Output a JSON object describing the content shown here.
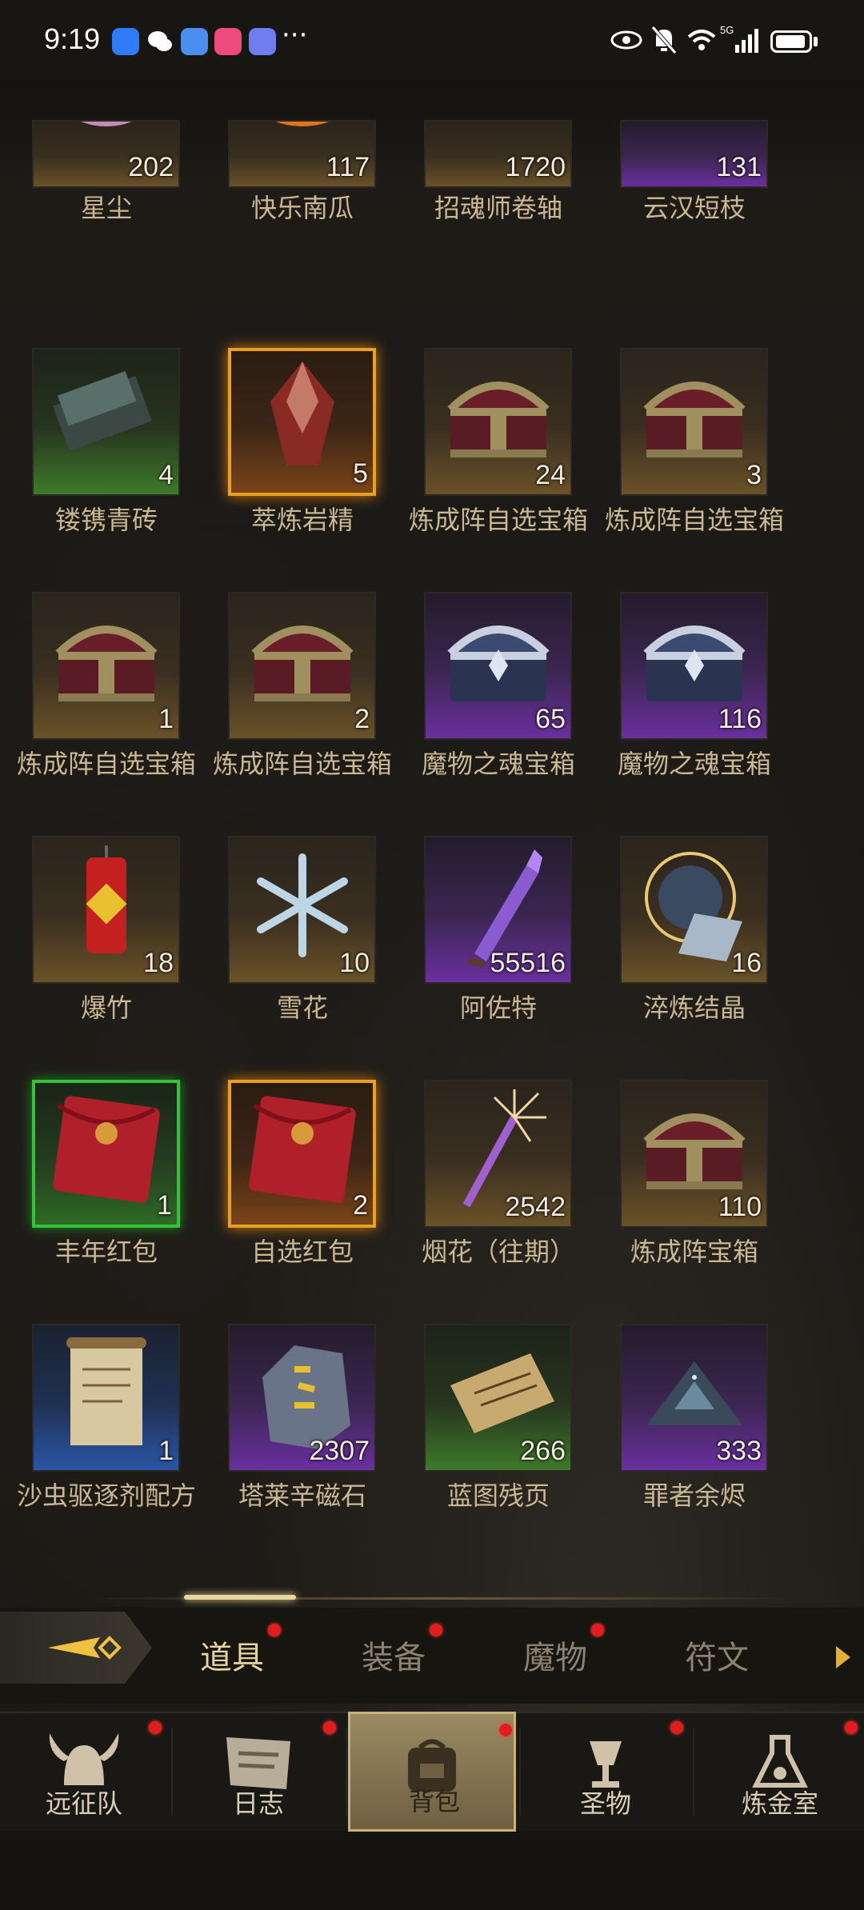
{
  "status_bar": {
    "time": "9:19",
    "dots": "···",
    "icons": [
      "shield-app-icon",
      "wechat-icon",
      "browser-app-icon",
      "lofter-app-icon",
      "music-app-icon",
      "eye-icon",
      "mute-bell-icon",
      "wifi-icon",
      "signal-5g-icon",
      "battery-icon"
    ],
    "network": "5G"
  },
  "items": [
    {
      "name": "星尘",
      "count": "202",
      "rarity": "gold",
      "icon": "stardust-icon"
    },
    {
      "name": "快乐南瓜",
      "count": "117",
      "rarity": "gold",
      "icon": "pumpkin-icon"
    },
    {
      "name": "招魂师卷轴",
      "count": "1720",
      "rarity": "gold",
      "icon": "scroll-icon"
    },
    {
      "name": "云汉短枝",
      "count": "131",
      "rarity": "purple",
      "icon": "branch-icon"
    },
    {
      "name": "镂镌青砖",
      "count": "4",
      "rarity": "green",
      "icon": "brick-icon"
    },
    {
      "name": "萃炼岩精",
      "count": "5",
      "rarity": "orange",
      "icon": "crystal-icon"
    },
    {
      "name": "炼成阵自选宝箱",
      "count": "24",
      "rarity": "gold",
      "icon": "chest-icon"
    },
    {
      "name": "炼成阵自选宝箱",
      "count": "3",
      "rarity": "gold",
      "icon": "chest-icon"
    },
    {
      "name": "炼成阵自选宝箱",
      "count": "1",
      "rarity": "gold",
      "icon": "chest-icon"
    },
    {
      "name": "炼成阵自选宝箱",
      "count": "2",
      "rarity": "gold",
      "icon": "chest-icon"
    },
    {
      "name": "魔物之魂宝箱",
      "count": "65",
      "rarity": "purple",
      "icon": "silver-chest-icon"
    },
    {
      "name": "魔物之魂宝箱",
      "count": "116",
      "rarity": "purple",
      "icon": "silver-chest-icon"
    },
    {
      "name": "爆竹",
      "count": "18",
      "rarity": "gold",
      "icon": "firecracker-icon"
    },
    {
      "name": "雪花",
      "count": "10",
      "rarity": "gold",
      "icon": "snowflake-icon"
    },
    {
      "name": "阿佐特",
      "count": "55516",
      "rarity": "purple",
      "icon": "azoth-vial-icon"
    },
    {
      "name": "淬炼结晶",
      "count": "16",
      "rarity": "gold",
      "icon": "rune-crystal-icon"
    },
    {
      "name": "丰年红包",
      "count": "1",
      "rarity": "lime",
      "icon": "red-envelope-icon"
    },
    {
      "name": "自选红包",
      "count": "2",
      "rarity": "orange",
      "icon": "red-envelope-icon"
    },
    {
      "name": "烟花（往期）",
      "count": "2542",
      "rarity": "gold",
      "icon": "firework-icon"
    },
    {
      "name": "炼成阵宝箱",
      "count": "110",
      "rarity": "gold",
      "icon": "chest-icon"
    },
    {
      "name": "沙虫驱逐剂配方",
      "count": "1",
      "rarity": "blue",
      "icon": "recipe-scroll-icon"
    },
    {
      "name": "塔莱辛磁石",
      "count": "2307",
      "rarity": "purple",
      "icon": "lodestone-icon"
    },
    {
      "name": "蓝图残页",
      "count": "266",
      "rarity": "green",
      "icon": "blueprint-page-icon"
    },
    {
      "name": "罪者余烬",
      "count": "333",
      "rarity": "purple",
      "icon": "ember-pile-icon"
    }
  ],
  "tabs": [
    {
      "label": "道具",
      "active": true
    },
    {
      "label": "装备",
      "active": false
    },
    {
      "label": "魔物",
      "active": false
    },
    {
      "label": "符文",
      "active": false
    }
  ],
  "nav": [
    {
      "label": "远征队",
      "icon": "viking-helmet-icon",
      "active": false
    },
    {
      "label": "日志",
      "icon": "journal-icon",
      "active": false
    },
    {
      "label": "背包",
      "icon": "backpack-icon",
      "active": true
    },
    {
      "label": "圣物",
      "icon": "chalice-icon",
      "active": false
    },
    {
      "label": "炼金室",
      "icon": "alchemy-icon",
      "active": false
    }
  ],
  "colors": {
    "badge_red": "#e21d1d",
    "tab_active": "#e8d4a2",
    "rarity_gold": "#6a5228",
    "rarity_purple": "#6a2fa0",
    "rarity_green": "#3e7a2a",
    "rarity_blue": "#2b55a6",
    "rarity_orange": "#e8a01e",
    "rarity_lime": "#34c23a"
  }
}
